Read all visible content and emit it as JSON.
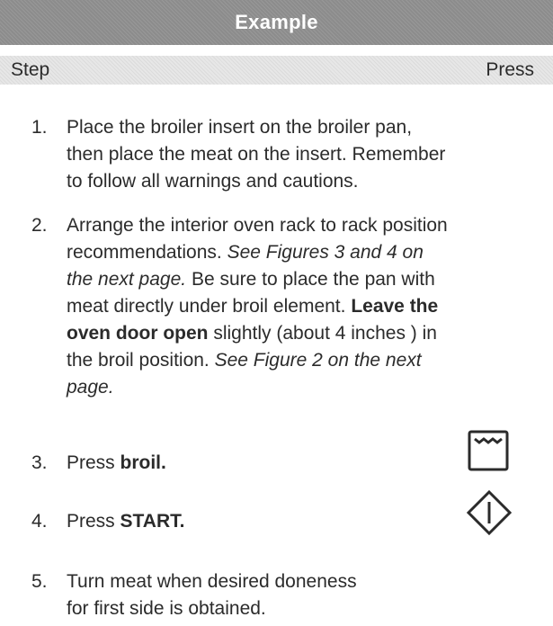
{
  "header": {
    "title": "Example"
  },
  "columns": {
    "step": "Step",
    "press": "Press"
  },
  "steps": [
    {
      "number": "1.",
      "lines": [
        "Place the broiler insert on the broiler pan,",
        "then place the meat on the insert. Remember",
        "to follow all warnings and cautions."
      ]
    },
    {
      "number": "2.",
      "line1": "Arrange the interior oven rack to rack position",
      "line2_a": "recommendations. ",
      "line2_b": "See Figures 3 and 4 on",
      "line3_a": "the next page.",
      "line3_b": " Be sure to place the pan with",
      "line4_a": "meat directly under broil element. ",
      "line4_b": "Leave the",
      "line5_a": "oven door open",
      "line5_b": " slightly (about 4 inches ) in",
      "line6_a": "the broil position. ",
      "line6_b": "See Figure 2 on the next",
      "line7": "page."
    },
    {
      "number": "3.",
      "prefix": "Press ",
      "key": "broil.",
      "icon": "broil-key-icon"
    },
    {
      "number": "4.",
      "prefix": "Press ",
      "key": "START.",
      "icon": "start-key-icon"
    },
    {
      "number": "5.",
      "lines": [
        "Turn meat when desired doneness",
        "for first side is obtained."
      ]
    }
  ]
}
